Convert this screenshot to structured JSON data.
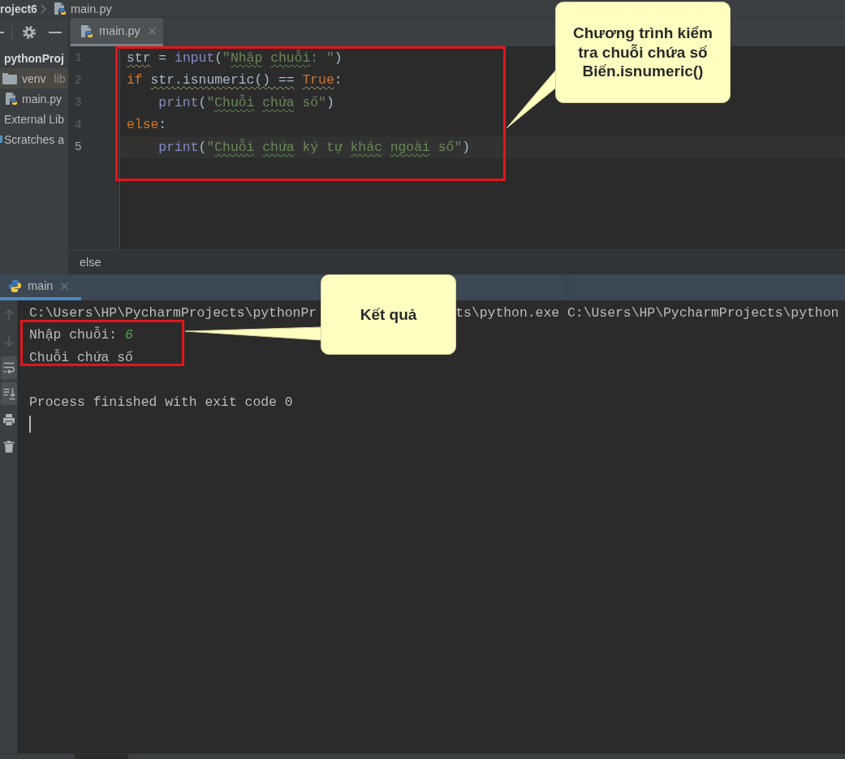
{
  "navigation_bar": {
    "project": "roject6",
    "file": "main.py"
  },
  "project_tree": [
    {
      "label": "pythonProj",
      "kind": "root",
      "selected": false,
      "children": [
        {
          "label": "venv",
          "note": "lib",
          "kind": "folder",
          "selected": true
        },
        {
          "label": "main.py",
          "kind": "python-file",
          "selected": false
        }
      ]
    },
    {
      "label": "External Lib",
      "kind": "library",
      "selected": false
    },
    {
      "label": "Scratches a",
      "kind": "scratches",
      "selected": false
    }
  ],
  "editor_tabs": [
    {
      "label": "main.py",
      "selected": true
    }
  ],
  "editor": {
    "lines": [
      {
        "number": "1",
        "current": false,
        "tokens": [
          {
            "text": "str",
            "kind": "name",
            "flagged": true
          },
          {
            "text": " = ",
            "kind": "plain",
            "flagged": false
          },
          {
            "text": "input",
            "kind": "builtin",
            "flagged": false
          },
          {
            "text": "(",
            "kind": "plain",
            "flagged": false
          },
          {
            "text": "\"",
            "kind": "string",
            "flagged": false
          },
          {
            "text": "Nhập ",
            "kind": "string",
            "flagged": true
          },
          {
            "text": "chuỗi",
            "kind": "string",
            "flagged": true
          },
          {
            "text": ": \"",
            "kind": "string",
            "flagged": false
          },
          {
            "text": ")",
            "kind": "plain",
            "flagged": false
          }
        ]
      },
      {
        "number": "2",
        "current": false,
        "tokens": [
          {
            "text": "if ",
            "kind": "keyword",
            "flagged": false
          },
          {
            "text": "str.isnumeric() == ",
            "kind": "plain",
            "flagged": true
          },
          {
            "text": "True",
            "kind": "keyword",
            "flagged": true
          },
          {
            "text": ":",
            "kind": "plain",
            "flagged": false
          }
        ]
      },
      {
        "number": "3",
        "current": false,
        "tokens": [
          {
            "text": "    print",
            "kind": "builtin",
            "flagged": false
          },
          {
            "text": "(",
            "kind": "plain",
            "flagged": false
          },
          {
            "text": "\"",
            "kind": "string",
            "flagged": false
          },
          {
            "text": "Chuỗi ",
            "kind": "string",
            "flagged": true
          },
          {
            "text": "chứa",
            "kind": "string",
            "flagged": true
          },
          {
            "text": " số\"",
            "kind": "string",
            "flagged": false
          },
          {
            "text": ")",
            "kind": "plain",
            "flagged": false
          }
        ]
      },
      {
        "number": "4",
        "current": false,
        "tokens": [
          {
            "text": "else",
            "kind": "keyword",
            "flagged": false
          },
          {
            "text": ":",
            "kind": "plain",
            "flagged": false
          }
        ]
      },
      {
        "number": "5",
        "current": true,
        "tokens": [
          {
            "text": "    print",
            "kind": "builtin",
            "flagged": false
          },
          {
            "text": "(",
            "kind": "plain",
            "flagged": false
          },
          {
            "text": "\"",
            "kind": "string",
            "flagged": false
          },
          {
            "text": "Chuỗi ",
            "kind": "string",
            "flagged": true
          },
          {
            "text": "chứa",
            "kind": "string",
            "flagged": true
          },
          {
            "text": " ký tự ",
            "kind": "string",
            "flagged": false
          },
          {
            "text": "khác ",
            "kind": "string",
            "flagged": true
          },
          {
            "text": "ngoài",
            "kind": "string",
            "flagged": true
          },
          {
            "text": " số\"",
            "kind": "string",
            "flagged": false
          },
          {
            "text": ")",
            "kind": "plain",
            "flagged": false
          }
        ]
      }
    ],
    "breadcrumb": "else"
  },
  "run_window": {
    "tabs": [
      {
        "label": "main",
        "selected": true
      }
    ],
    "toolbar": [
      {
        "kind": "previous",
        "disabled": true,
        "on": false
      },
      {
        "kind": "next",
        "disabled": true,
        "on": false
      },
      {
        "kind": "soft-wrap",
        "disabled": false,
        "on": true
      },
      {
        "kind": "scroll-to-end",
        "disabled": false,
        "on": true
      },
      {
        "kind": "print",
        "disabled": false,
        "on": false
      },
      {
        "kind": "clear",
        "disabled": false,
        "on": false
      }
    ],
    "console": [
      {
        "kind": "command",
        "segments": [
          {
            "text": "C:\\Users\\HP\\PycharmProjects\\pythonPr",
            "kind": "output"
          },
          {
            "text": "ts\\python.exe C:\\Users\\HP\\PycharmProjects\\python",
            "kind": "output"
          }
        ]
      },
      {
        "kind": "output",
        "segments": [
          {
            "text": "Nhập chuỗi: ",
            "kind": "output"
          },
          {
            "text": "6",
            "kind": "input"
          }
        ]
      },
      {
        "kind": "output",
        "segments": [
          {
            "text": "Chuỗi chứa số",
            "kind": "output"
          }
        ]
      },
      {
        "kind": "exit",
        "segments": [
          {
            "text": "Process finished with exit code 0",
            "kind": "output"
          }
        ]
      }
    ]
  },
  "annotations": [
    {
      "text": "Chương trình kiểm\ntra chuỗi chứa số\nBiến.isnumeric()"
    },
    {
      "text": "Kết quả"
    }
  ]
}
